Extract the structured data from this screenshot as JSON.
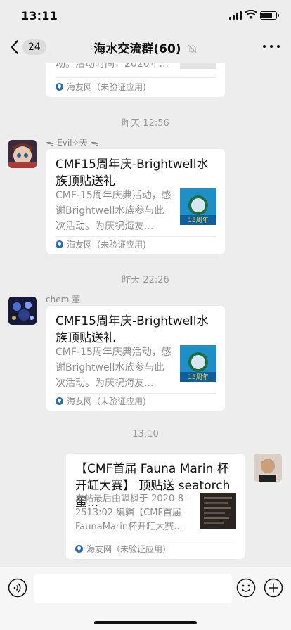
{
  "status": {
    "time": "13:11"
  },
  "nav": {
    "unread": "24",
    "title": "海水交流群(60)"
  },
  "top_card": {
    "desc_tail": "动。活动时间：2020年...",
    "source": "海友网（未验证应用)"
  },
  "timestamps": [
    "昨天 12:56",
    "昨天 22:26",
    "13:10"
  ],
  "messages": [
    {
      "sender": "ᯓ-Evil✧天-ᯓ",
      "title": "CMF15周年庆-Brightwell水族顶贴送礼",
      "desc": "CMF-15周年庆典活动，感谢Brightwell水族参与此次活动。为庆祝海友...",
      "thumb_text": "15周年",
      "source": "海友网（未验证应用)"
    },
    {
      "sender": "chem 董",
      "title": "CMF15周年庆-Brightwell水族顶贴送礼",
      "desc": "CMF-15周年庆典活动，感谢Brightwell水族参与此次活动。为庆祝海友...",
      "thumb_text": "15周年",
      "source": "海友网（未验证应用)"
    },
    {
      "sender": "",
      "title": "【CMF首届 Fauna Marin 杯开缸大赛】 顶贴送 seatorch 蛋...",
      "desc": "本帖最后由飒枫于 2020-8-2513:02 编辑【CMF首届FaunaMarin杯开缸大赛...",
      "source": "海友网（未验证应用)"
    }
  ],
  "icons": {
    "back": "chevron-left-icon",
    "mute": "bell-slash-icon",
    "more": "more-dots-icon",
    "voice": "voice-icon",
    "emoji": "emoji-icon",
    "plus": "plus-icon"
  },
  "colors": {
    "background": "#ededed",
    "card": "#ffffff",
    "brand_thumb": "#1f8fc8"
  }
}
